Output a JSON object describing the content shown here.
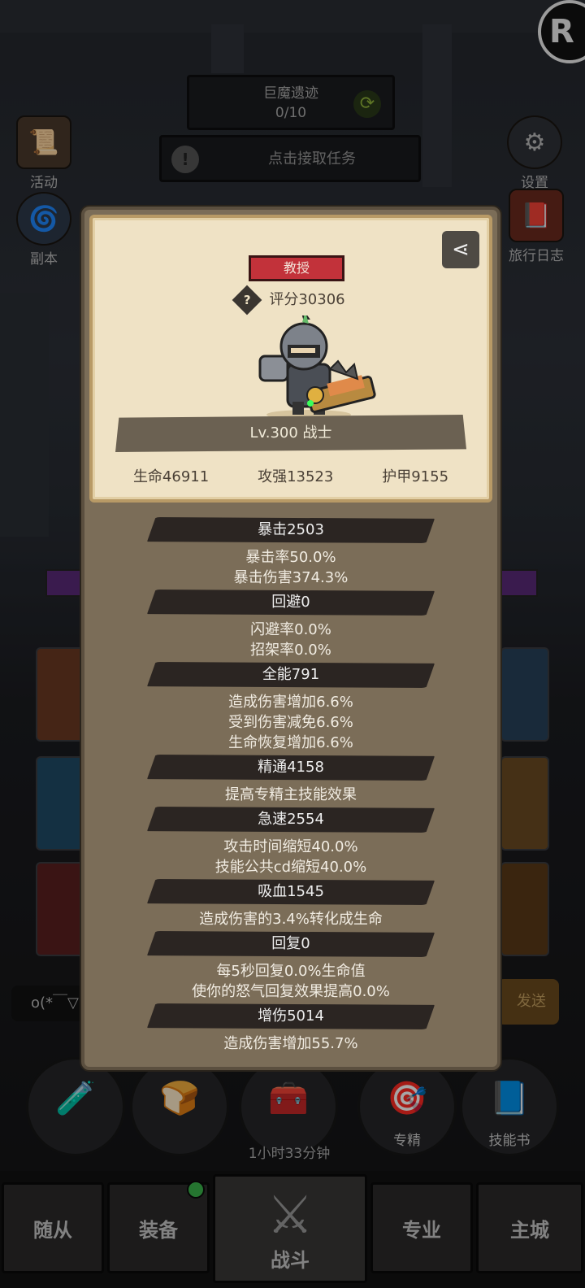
{
  "hud": {
    "quest_name": "巨魔遗迹",
    "quest_progress": "0/10",
    "accept_task": "点击接取任务",
    "left_icons": [
      {
        "label": "活动"
      },
      {
        "label": "副本"
      }
    ],
    "right_icons": [
      {
        "label": "设置"
      },
      {
        "label": "旅行日志"
      }
    ],
    "chat_text": "o(*￣▽",
    "send_label": "发送",
    "timer": "1小时33分钟",
    "round_buttons": [
      {
        "label": ""
      },
      {
        "label": ""
      },
      {
        "label": "专精"
      },
      {
        "label": "技能书"
      }
    ]
  },
  "bottom_nav": {
    "tabs": [
      "随从",
      "装备",
      "战斗",
      "专业",
      "主城"
    ],
    "active": "战斗"
  },
  "character": {
    "title": "教授",
    "score": "评分30306",
    "level_class": "Lv.300 战士",
    "hp": "生命46911",
    "attack": "攻强13523",
    "armor": "护甲9155"
  },
  "attributes": [
    {
      "name": "暴击2503",
      "details": [
        "暴击率50.0%",
        "暴击伤害374.3%"
      ]
    },
    {
      "name": "回避0",
      "details": [
        "闪避率0.0%",
        "招架率0.0%"
      ]
    },
    {
      "name": "全能791",
      "details": [
        "造成伤害增加6.6%",
        "受到伤害减免6.6%",
        "生命恢复增加6.6%"
      ]
    },
    {
      "name": "精通4158",
      "details": [
        "提高专精主技能效果"
      ]
    },
    {
      "name": "急速2554",
      "details": [
        "攻击时间缩短40.0%",
        "技能公共cd缩短40.0%"
      ]
    },
    {
      "name": "吸血1545",
      "details": [
        "造成伤害的3.4%转化成生命"
      ]
    },
    {
      "name": "回复0",
      "details": [
        "每5秒回复0.0%生命值",
        "使你的怒气回复效果提高0.0%"
      ]
    },
    {
      "name": "增伤5014",
      "details": [
        "造成伤害增加55.7%"
      ]
    }
  ],
  "colors": {
    "panel": "#7b6d58",
    "parchment": "#efe2c5",
    "badge": "#c2323a",
    "attr_header": "#2b2522"
  }
}
